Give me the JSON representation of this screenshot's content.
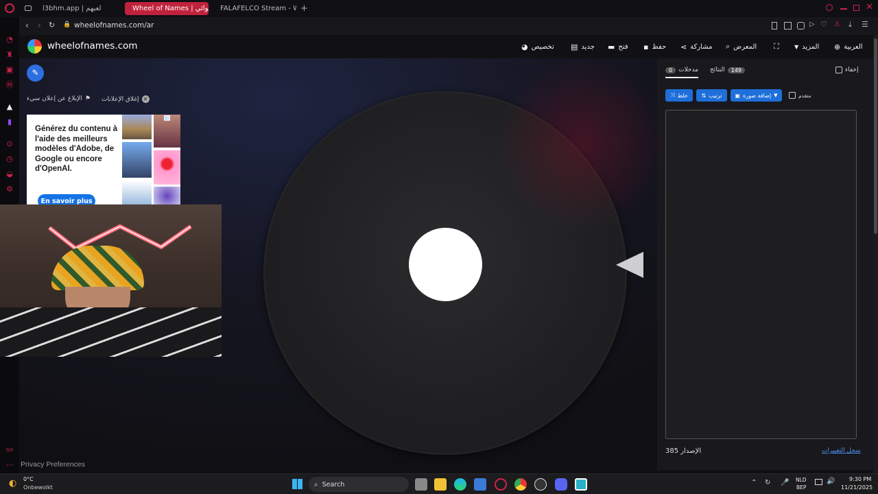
{
  "browser": {
    "tabs": [
      {
        "label": "l3bhm.app | لعبهم",
        "active": false
      },
      {
        "label": "Wheel of Names | عشوائي",
        "active": true
      },
      {
        "label": "FALAFELCO Stream - Wat",
        "active": false
      }
    ],
    "url": "wheelofnames.com/ar"
  },
  "site": {
    "brand": "wheelofnames.com",
    "nav": {
      "customize": "تخصيص",
      "new": "جديد",
      "open": "فتح",
      "save": "حفظ",
      "share": "مشاركة",
      "gallery": "المعرض",
      "more": "المزيد",
      "language": "العربية"
    }
  },
  "ads": {
    "close_ads": "إغلاق الإعلانات",
    "report_ad": "الإبلاغ عن إعلان سيء",
    "text": "Générez du contenu à l'aide des meilleurs modèles d'Adobe, de Google ou encore d'OpenAI.",
    "cta": "En savoir plus"
  },
  "panel": {
    "tab_entries": "مدخلات",
    "tab_entries_count": "0",
    "tab_results": "النتائج",
    "tab_results_count": "149",
    "hide": "إخفاء",
    "shuffle": "خلط",
    "sort": "ترتيب",
    "add_image": "إضافة صورة",
    "advanced": "متقدم",
    "version": "الإصدار 385",
    "changelog": "سجل التغييرات"
  },
  "footer": {
    "privacy": "Privacy Preferences"
  },
  "taskbar": {
    "weather_temp": "0°C",
    "weather_desc": "Onbewolkt",
    "search": "Search",
    "lang_line1": "NLD",
    "lang_line2": "BEP",
    "time": "9:30 PM",
    "date": "11/21/2025"
  },
  "colors": {
    "accent_blue": "#1e6fd9",
    "opera_red": "#d0224a",
    "wheel": "#232326",
    "pointer": "#cfcfd2"
  }
}
